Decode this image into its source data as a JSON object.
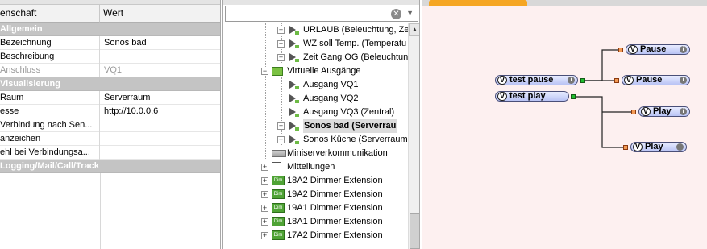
{
  "properties": {
    "col_name": "enschaft",
    "col_value": "Wert",
    "rows": [
      {
        "type": "cat",
        "key": "Allgemein",
        "value": ""
      },
      {
        "type": "row",
        "key": "Bezeichnung",
        "value": "Sonos bad"
      },
      {
        "type": "row",
        "key": "Beschreibung",
        "value": ""
      },
      {
        "type": "dis",
        "key": "Anschluss",
        "value": "VQ1"
      },
      {
        "type": "cat",
        "key": "Visualisierung",
        "value": ""
      },
      {
        "type": "row",
        "key": "Raum",
        "value": "Serverraum"
      },
      {
        "type": "row",
        "key": "esse",
        "value": "http://10.0.0.6"
      },
      {
        "type": "row",
        "key": "Verbindung nach Sen...",
        "value": ""
      },
      {
        "type": "row",
        "key": "anzeichen",
        "value": ""
      },
      {
        "type": "row",
        "key": "ehl bei Verbindungsa...",
        "value": ""
      },
      {
        "type": "cat",
        "key": "Logging/Mail/Call/Track",
        "value": ""
      }
    ]
  },
  "search": {
    "value": "",
    "placeholder": ""
  },
  "tree": {
    "items": [
      {
        "label": "URLAUB (Beleuchtung, Ze",
        "icon": "arrow-output-icon",
        "bold": false
      },
      {
        "label": "WZ soll Temp. (Temperatu",
        "icon": "arrow-output-icon",
        "bold": false
      },
      {
        "label": "Zeit Gang OG (Beleuchtun",
        "icon": "arrow-output-icon",
        "bold": false
      },
      {
        "label": "Virtuelle Ausgänge",
        "icon": "folder-icon",
        "bold": false
      },
      {
        "label": "Ausgang VQ1",
        "icon": "arrow-output-icon",
        "bold": false
      },
      {
        "label": "Ausgang VQ2",
        "icon": "arrow-output-icon",
        "bold": false
      },
      {
        "label": "Ausgang VQ3 (Zentral)",
        "icon": "arrow-output-icon",
        "bold": false
      },
      {
        "label": "Sonos bad (Serverrau",
        "icon": "arrow-output-icon",
        "bold": true
      },
      {
        "label": "Sonos Küche (Serverraum",
        "icon": "arrow-output-icon",
        "bold": false
      },
      {
        "label": "Miniserverkommunikation",
        "icon": "network-icon",
        "bold": false
      },
      {
        "label": "Mitteilungen",
        "icon": "message-icon",
        "bold": false
      },
      {
        "label": "18A2 Dimmer Extension",
        "icon": "dimmer-icon",
        "bold": false
      },
      {
        "label": "19A2 Dimmer Extension",
        "icon": "dimmer-icon",
        "bold": false
      },
      {
        "label": "19A1 Dimmer Extension",
        "icon": "dimmer-icon",
        "bold": false
      },
      {
        "label": "18A1 Dimmer Extension",
        "icon": "dimmer-icon",
        "bold": false
      },
      {
        "label": "17A2 Dimmer Extension",
        "icon": "dimmer-icon",
        "bold": false
      }
    ]
  },
  "diagram": {
    "badge": "V",
    "info_glyph": "i",
    "blocks": {
      "test_pause": "test pause",
      "test_play": "test play",
      "pause_1": "Pause",
      "pause_2": "Pause",
      "play_1": "Play",
      "play_2": "Play"
    }
  },
  "colors": {
    "category_bg": "#c4c4c4",
    "diagram_bg": "#fdf0f0",
    "block_fill": "#b9c3f5",
    "port_green": "#1fbf2f",
    "port_orange": "#f29a55",
    "tab_accent": "#f5a623"
  }
}
